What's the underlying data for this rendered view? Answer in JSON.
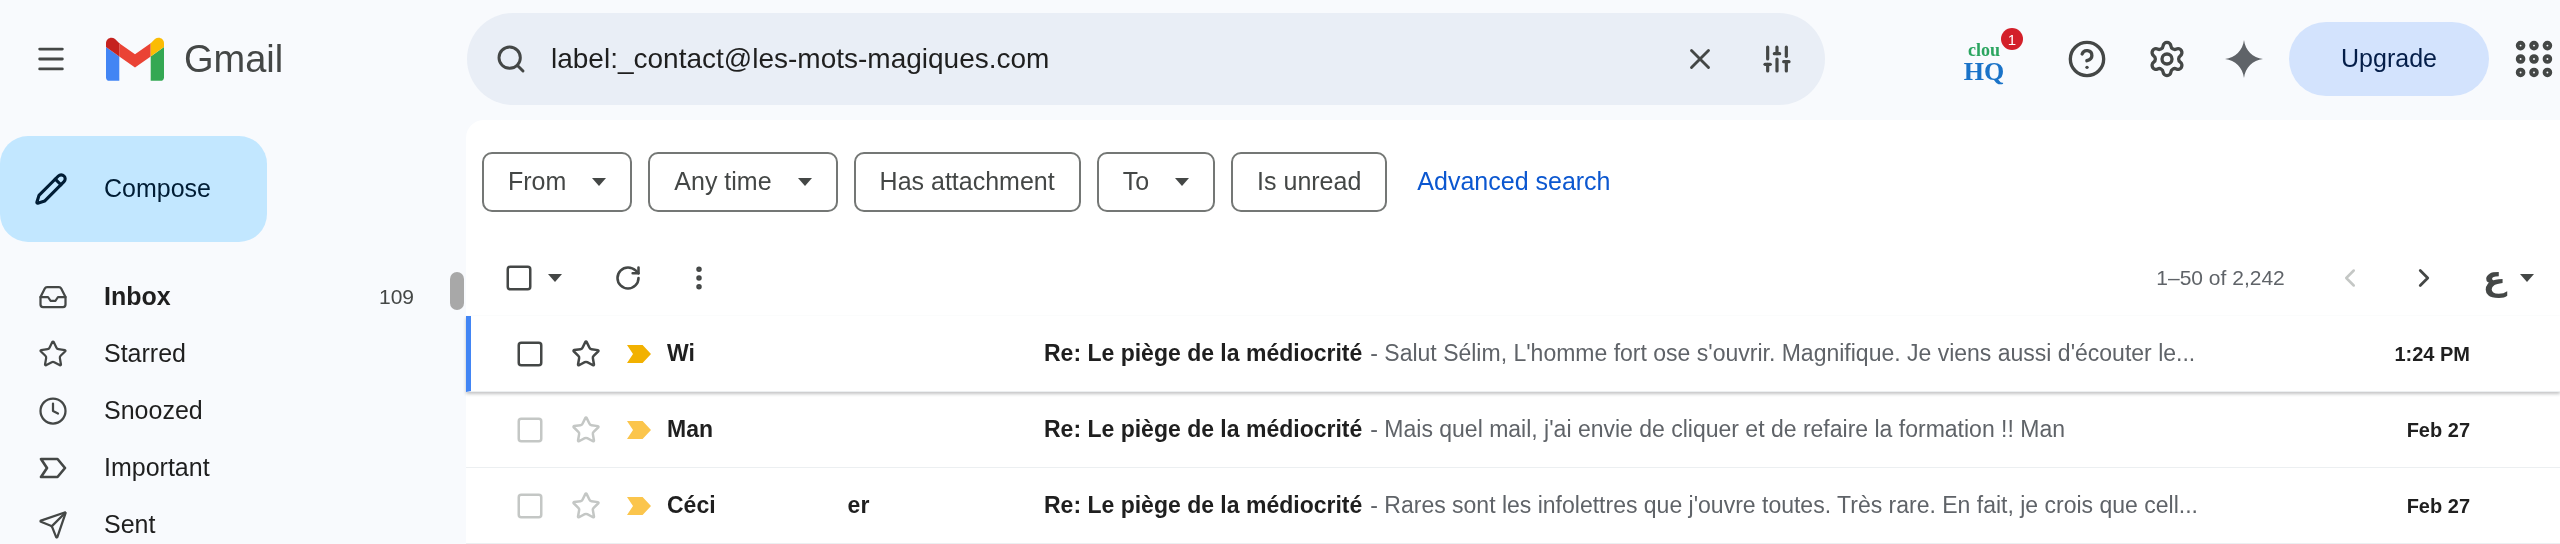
{
  "header": {
    "app_name": "Gmail",
    "search": {
      "value": "label:_contact@les-mots-magiques.com"
    },
    "addon": {
      "top": "clou",
      "bottom": "HQ",
      "badge": "1"
    },
    "upgrade": "Upgrade"
  },
  "compose": "Compose",
  "nav": [
    {
      "kind": "inbox",
      "label": "Inbox",
      "count": "109",
      "unread": true
    },
    {
      "kind": "starred",
      "label": "Starred",
      "unread": false
    },
    {
      "kind": "snoozed",
      "label": "Snoozed",
      "unread": false
    },
    {
      "kind": "important",
      "label": "Important",
      "unread": false
    },
    {
      "kind": "sent",
      "label": "Sent",
      "unread": false
    }
  ],
  "filters": [
    {
      "label": "From",
      "dropdown": true
    },
    {
      "label": "Any time",
      "dropdown": true
    },
    {
      "label": "Has attachment",
      "dropdown": false
    },
    {
      "label": "To",
      "dropdown": true
    },
    {
      "label": "Is unread",
      "dropdown": false
    }
  ],
  "advanced_search": "Advanced search",
  "toolbar": {
    "select_all_checked": false,
    "range": "1–50 of 2,242",
    "prev_disabled": true,
    "input_tool": "ع"
  },
  "rows": [
    {
      "sender": "Wi",
      "subject": "Re: Le piège de la médiocrité",
      "snippet": "- Salut Sélim, L'homme fort ose s'ouvrir. Magnifique. Je viens aussi d'écouter le...",
      "time": "1:24 PM",
      "focused": true,
      "checked": false,
      "starred": false,
      "important": true
    },
    {
      "sender": "Man",
      "subject": "Re: Le piège de la médiocrité",
      "snippet": "- Mais quel mail, j'ai envie de cliquer et de refaire la formation !! Man",
      "time": "Feb 27",
      "focused": false,
      "checked": false,
      "starred": false,
      "important": true
    },
    {
      "sender": "Céci",
      "sender_extra": "er",
      "subject": "Re: Le piège de la médiocrité",
      "snippet": "- Rares sont les infolettres que j'ouvre toutes. Très rare. En fait, je crois que cell...",
      "time": "Feb 27",
      "focused": false,
      "checked": false,
      "starred": false,
      "important": true
    }
  ]
}
